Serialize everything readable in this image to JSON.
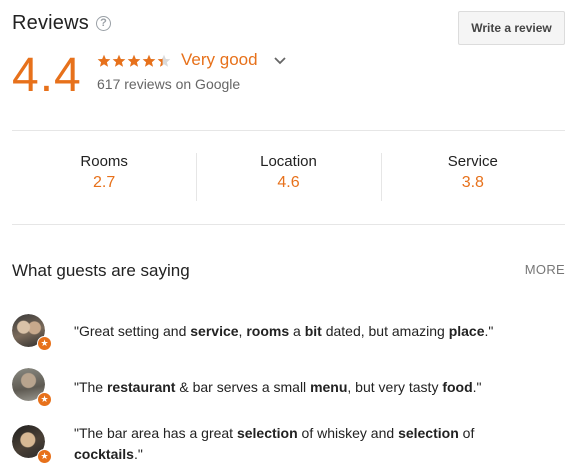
{
  "header": {
    "title": "Reviews",
    "help_icon": "?",
    "write_review_label": "Write a review",
    "rating_value": "4.4",
    "stars_filled": 4.4,
    "stars_total": 5,
    "rating_label": "Very good",
    "review_count_text": "617 reviews on Google"
  },
  "categories": [
    {
      "name": "Rooms",
      "score": "2.7"
    },
    {
      "name": "Location",
      "score": "4.6"
    },
    {
      "name": "Service",
      "score": "3.8"
    }
  ],
  "guests": {
    "section_title": "What guests are saying",
    "more_label": "MORE",
    "snippets": [
      {
        "parts": [
          {
            "text": "\"Great setting and ",
            "bold": false
          },
          {
            "text": "service",
            "bold": true
          },
          {
            "text": ", ",
            "bold": false
          },
          {
            "text": "rooms",
            "bold": true
          },
          {
            "text": " a ",
            "bold": false
          },
          {
            "text": "bit",
            "bold": true
          },
          {
            "text": " dated, but amazing ",
            "bold": false
          },
          {
            "text": "place",
            "bold": true
          },
          {
            "text": ".\"",
            "bold": false
          }
        ]
      },
      {
        "parts": [
          {
            "text": "\"The ",
            "bold": false
          },
          {
            "text": "restaurant",
            "bold": true
          },
          {
            "text": " & bar serves a small ",
            "bold": false
          },
          {
            "text": "menu",
            "bold": true
          },
          {
            "text": ", but very tasty ",
            "bold": false
          },
          {
            "text": "food",
            "bold": true
          },
          {
            "text": ".\"",
            "bold": false
          }
        ]
      },
      {
        "parts": [
          {
            "text": "\"The bar area has a great ",
            "bold": false
          },
          {
            "text": "selection",
            "bold": true
          },
          {
            "text": " of whiskey and ",
            "bold": false
          },
          {
            "text": "selection",
            "bold": true
          },
          {
            "text": " of ",
            "bold": false
          },
          {
            "text": "cocktails",
            "bold": true
          },
          {
            "text": ".\"",
            "bold": false
          }
        ]
      }
    ],
    "badge_icon": "local-guide-star-icon"
  },
  "colors": {
    "accent": "#e7711b",
    "text": "#222222",
    "muted": "#666666",
    "divider": "#e6e6e6"
  }
}
